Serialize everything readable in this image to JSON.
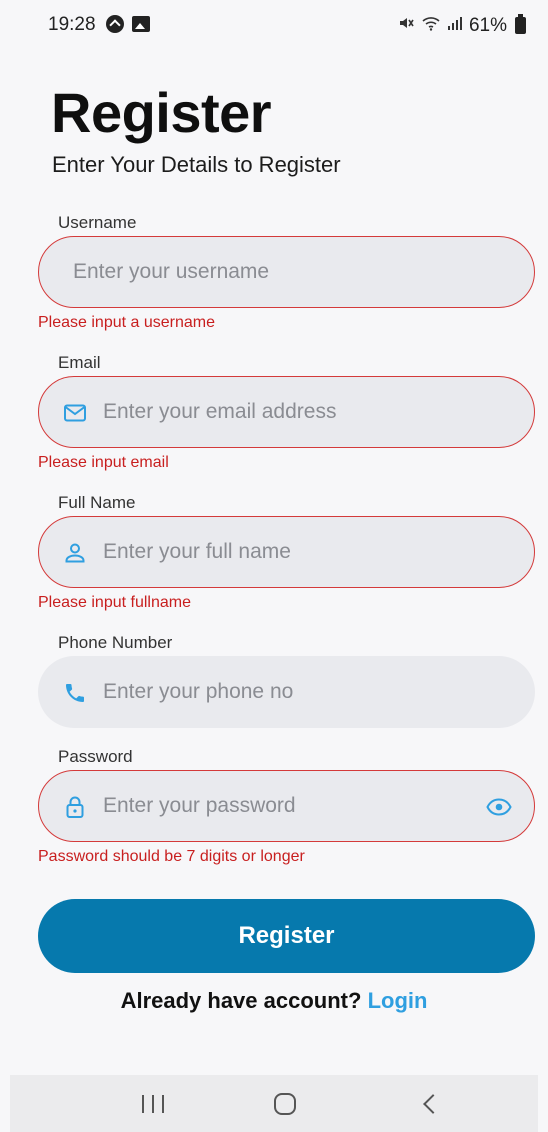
{
  "status_bar": {
    "time": "19:28",
    "battery": "61%",
    "icons": [
      "navigation-icon",
      "gallery-icon",
      "mute-icon",
      "wifi-icon",
      "signal-icon",
      "battery-icon"
    ]
  },
  "header": {
    "title": "Register",
    "subtitle": "Enter Your Details to Register"
  },
  "form": {
    "username": {
      "label": "Username",
      "placeholder": "Enter your username",
      "value": "",
      "error": "Please input a username"
    },
    "email": {
      "label": "Email",
      "placeholder": "Enter your email address",
      "value": "",
      "icon": "mail-icon",
      "error": "Please input email"
    },
    "full_name": {
      "label": "Full Name",
      "placeholder": "Enter your full name",
      "value": "",
      "icon": "person-icon",
      "error": "Please input fullname"
    },
    "phone": {
      "label": "Phone Number",
      "placeholder": "Enter your phone no",
      "value": "",
      "icon": "phone-icon"
    },
    "password": {
      "label": "Password",
      "placeholder": "Enter your password",
      "value": "",
      "icon": "lock-icon",
      "toggle_icon": "eye-icon",
      "error": "Password should be 7 digits or longer"
    },
    "submit_label": "Register"
  },
  "footer": {
    "prompt": "Already have account?",
    "link": "Login"
  },
  "colors": {
    "accent": "#0679ad",
    "link": "#2f9fe0",
    "error": "#c81f1f",
    "icon": "#2f9fe0",
    "field_bg": "#e9eaee"
  }
}
